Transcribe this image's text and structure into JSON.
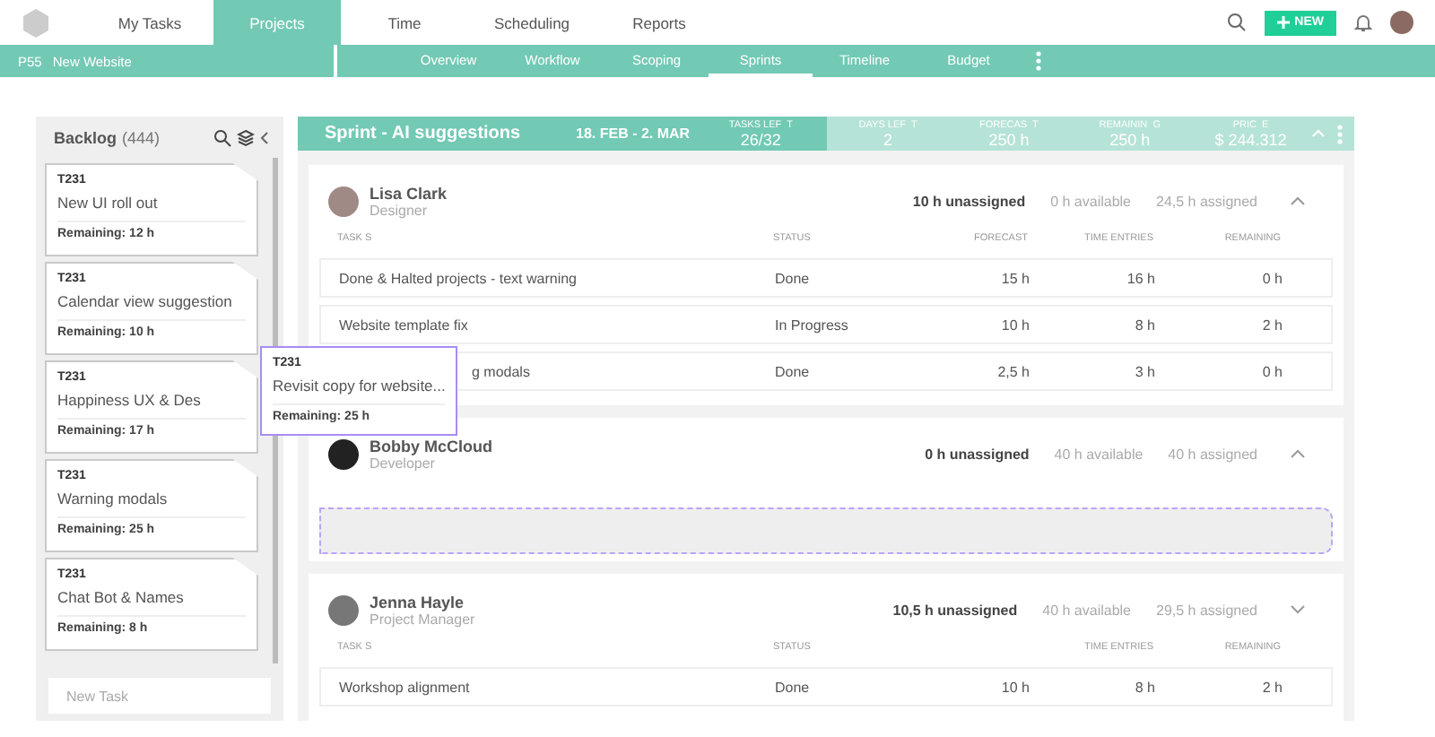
{
  "top_nav": {
    "items": [
      {
        "label": "My Tasks",
        "selected": false
      },
      {
        "label": "Projects",
        "selected": true
      },
      {
        "label": "Time",
        "selected": false
      },
      {
        "label": "Scheduling",
        "selected": false
      },
      {
        "label": "Reports",
        "selected": false
      }
    ],
    "new_button": "NEW"
  },
  "project_bar": {
    "code": "P55",
    "name": "New Website",
    "tabs": [
      {
        "label": "Overview",
        "selected": false
      },
      {
        "label": "Workflow",
        "selected": false
      },
      {
        "label": "Scoping",
        "selected": false
      },
      {
        "label": "Sprints",
        "selected": true
      },
      {
        "label": "Timeline",
        "selected": false
      },
      {
        "label": "Budget",
        "selected": false
      }
    ]
  },
  "backlog": {
    "title": "Backlog",
    "count": "(444)",
    "cards": [
      {
        "id": "T231",
        "title": "New UI roll out",
        "remaining": "Remaining: 12 h"
      },
      {
        "id": "T231",
        "title": "Calendar view suggestion",
        "remaining": "Remaining: 10 h"
      },
      {
        "id": "T231",
        "title": "Happiness UX & Des",
        "remaining": "Remaining: 17 h"
      },
      {
        "id": "T231",
        "title": "Warning modals",
        "remaining": "Remaining: 25 h"
      },
      {
        "id": "T231",
        "title": "Chat Bot & Names",
        "remaining": "Remaining: 8 h"
      }
    ],
    "new_task_placeholder": "New Task"
  },
  "dragged_card": {
    "id": "T231",
    "title": "Revisit copy for website...",
    "remaining": "Remaining: 25 h"
  },
  "sprint": {
    "title": "Sprint - AI suggestions",
    "dates": "18. FEB - 2. MAR",
    "stats": [
      {
        "label": "TASKS LEF  T",
        "value": "26/32",
        "highlighted": true
      },
      {
        "label": "DAYS LEF  T",
        "value": "2",
        "highlighted": false
      },
      {
        "label": "FORECAS  T",
        "value": "250 h",
        "highlighted": false
      },
      {
        "label": "REMAININ  G",
        "value": "250 h",
        "highlighted": false
      },
      {
        "label": "PRIC  E",
        "value": "$ 244.312",
        "highlighted": false
      }
    ]
  },
  "members": [
    {
      "name": "Lisa Clark",
      "role": "Designer",
      "unassigned": "10 h unassigned",
      "available": "0 h available",
      "assigned": "24,5 h assigned",
      "expanded": true,
      "drop_zone": false,
      "columns": [
        {
          "kind": "task",
          "label": "TASK S"
        },
        {
          "kind": "status",
          "label": "STATUS"
        },
        {
          "kind": "forecast",
          "label": "FORECAST"
        },
        {
          "kind": "time",
          "label": "TIME ENTRIES"
        },
        {
          "kind": "remaining",
          "label": "REMAINING"
        }
      ],
      "tasks": [
        {
          "name": "Done & Halted projects - text warning",
          "status": "Done",
          "forecast": "15 h",
          "time": "16 h",
          "remaining": "0 h"
        },
        {
          "name": "Website template fix",
          "status": "In Progress",
          "forecast": "10 h",
          "time": "8 h",
          "remaining": "2 h"
        },
        {
          "name": "g modals",
          "status": "Done",
          "forecast": "2,5 h",
          "time": "3 h",
          "remaining": "0 h"
        }
      ]
    },
    {
      "name": "Bobby McCloud",
      "role": "Developer",
      "unassigned": "0 h unassigned",
      "available": "40 h available",
      "assigned": "40 h assigned",
      "expanded": true,
      "drop_zone": true
    },
    {
      "name": "Jenna Hayle",
      "role": "Project Manager",
      "unassigned": "10,5 h unassigned",
      "available": "40 h available",
      "assigned": "29,5 h assigned",
      "expanded": false,
      "drop_zone": false,
      "columns": [
        {
          "kind": "task",
          "label": "TASK S"
        },
        {
          "kind": "status",
          "label": "STATUS"
        },
        {
          "kind": "time",
          "label": "TIME ENTRIES"
        },
        {
          "kind": "remaining",
          "label": "REMAINING"
        }
      ],
      "tasks": [
        {
          "name": "Workshop alignment",
          "status": "Done",
          "forecast": "10 h",
          "time": "8 h",
          "remaining": "2 h"
        }
      ]
    }
  ]
}
